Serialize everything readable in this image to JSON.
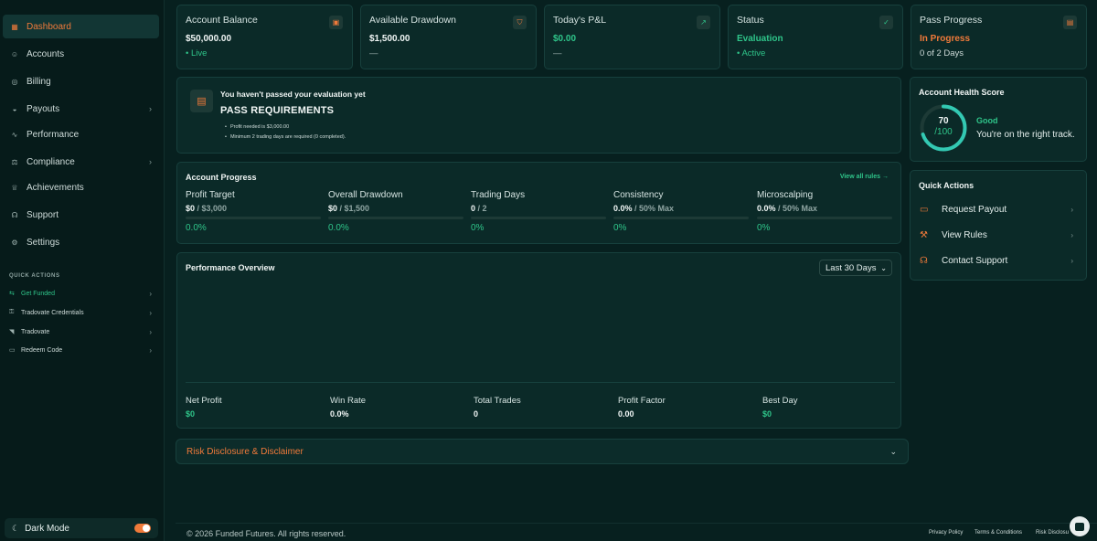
{
  "sidebar": {
    "nav": [
      {
        "label": "Dashboard",
        "icon": "grid-icon",
        "chevron": false,
        "active": true
      },
      {
        "label": "Accounts",
        "icon": "users-icon",
        "chevron": false,
        "active": false
      },
      {
        "label": "Billing",
        "icon": "billing-icon",
        "chevron": false,
        "active": false
      },
      {
        "label": "Payouts",
        "icon": "wallet-icon",
        "chevron": true,
        "active": false
      },
      {
        "label": "Performance",
        "icon": "chart-line-icon",
        "chevron": false,
        "active": false
      },
      {
        "label": "Compliance",
        "icon": "scale-icon",
        "chevron": true,
        "active": false
      },
      {
        "label": "Achievements",
        "icon": "trophy-icon",
        "chevron": false,
        "active": false
      },
      {
        "label": "Support",
        "icon": "headset-icon",
        "chevron": false,
        "active": false
      },
      {
        "label": "Settings",
        "icon": "gear-icon",
        "chevron": false,
        "active": false
      }
    ],
    "quick_actions_title": "QUICK ACTIONS",
    "quick_actions": [
      {
        "label": "Get Funded",
        "icon": "funded-icon",
        "highlight": true
      },
      {
        "label": "Tradovate Credentials",
        "icon": "key-icon",
        "highlight": false
      },
      {
        "label": "Tradovate",
        "icon": "tradovate-icon",
        "highlight": false
      },
      {
        "label": "Redeem Code",
        "icon": "ticket-icon",
        "highlight": false
      }
    ],
    "dark_mode_label": "Dark Mode"
  },
  "stats": {
    "balance": {
      "label": "Account Balance",
      "value": "$50,000.00",
      "sub": "• Live"
    },
    "drawdown": {
      "label": "Available Drawdown",
      "value": "$1,500.00",
      "sub": "—"
    },
    "pnl": {
      "label": "Today's P&L",
      "value": "$0.00",
      "sub": "—"
    },
    "status": {
      "label": "Status",
      "value": "Evaluation",
      "sub": "• Active"
    },
    "pass": {
      "label": "Pass Progress",
      "value": "In Progress",
      "sub": "0 of 2 Days"
    }
  },
  "requirements": {
    "notice": "You haven't passed your evaluation yet",
    "heading": "PASS REQUIREMENTS",
    "items": [
      "Profit needed is $3,000.00",
      "Minimum 2 trading days are required (0 completed)."
    ]
  },
  "progress": {
    "title": "Account Progress",
    "view_all": "View all rules →",
    "items": [
      {
        "label": "Profit Target",
        "value": "$0",
        "limit": " / $3,000",
        "percent": "0.0%",
        "fill": 0
      },
      {
        "label": "Overall Drawdown",
        "value": "$0",
        "limit": " / $1,500",
        "percent": "0.0%",
        "fill": 0
      },
      {
        "label": "Trading Days",
        "value": "0",
        "limit": " / 2",
        "percent": "0%",
        "fill": 0
      },
      {
        "label": "Consistency",
        "value": "0.0%",
        "limit": " / 50% Max",
        "percent": "0%",
        "fill": 0
      },
      {
        "label": "Microscalping",
        "value": "0.0%",
        "limit": " / 50% Max",
        "percent": "0%",
        "fill": 0
      }
    ]
  },
  "performance": {
    "title": "Performance Overview",
    "range": "Last 30 Days",
    "metrics": [
      {
        "label": "Net Profit",
        "value": "$0",
        "green": true
      },
      {
        "label": "Win Rate",
        "value": "0.0%",
        "green": false
      },
      {
        "label": "Total Trades",
        "value": "0",
        "green": false
      },
      {
        "label": "Profit Factor",
        "value": "0.00",
        "green": false
      },
      {
        "label": "Best Day",
        "value": "$0",
        "green": true
      }
    ]
  },
  "disclaimer": {
    "label": "Risk Disclosure & Disclaimer"
  },
  "health": {
    "title": "Account Health Score",
    "score": "70",
    "max": "/100",
    "score_fraction": 0.7,
    "status": "Good",
    "message": "You're on the right track."
  },
  "quick_actions_right": {
    "title": "Quick Actions",
    "items": [
      {
        "label": "Request Payout",
        "icon": "payout-icon"
      },
      {
        "label": "View Rules",
        "icon": "gavel-icon"
      },
      {
        "label": "Contact Support",
        "icon": "headset-icon"
      }
    ]
  },
  "footer": {
    "copyright": "© 2026 Funded Futures. All rights reserved.",
    "links": [
      "Privacy Policy",
      "Terms & Conditions",
      "Risk Disclosu"
    ]
  },
  "colors": {
    "accent": "#f07a3a",
    "positive": "#2fc58a",
    "background": "#07201f"
  }
}
